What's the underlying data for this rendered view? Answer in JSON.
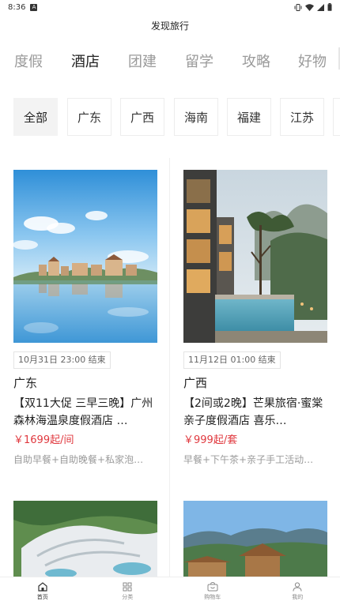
{
  "status_bar": {
    "time": "8:36",
    "app_badge": "A"
  },
  "header": {
    "title": "发现旅行"
  },
  "category_tabs": [
    {
      "label": "度假"
    },
    {
      "label": "酒店",
      "active": true
    },
    {
      "label": "团建"
    },
    {
      "label": "留学"
    },
    {
      "label": "攻略"
    },
    {
      "label": "好物"
    }
  ],
  "region_chips": [
    {
      "label": "全部",
      "active": true
    },
    {
      "label": "广东"
    },
    {
      "label": "广西"
    },
    {
      "label": "海南"
    },
    {
      "label": "福建"
    },
    {
      "label": "江苏"
    }
  ],
  "products": [
    {
      "end_time": "10月31日 23:00 结束",
      "region": "广东",
      "title": "【双11大促 三早三晚】广州森林海温泉度假酒店 …",
      "price": "￥1699起/间",
      "desc": "自助早餐+自助晚餐+私家泡…"
    },
    {
      "end_time": "11月12日 01:00 结束",
      "region": "广西",
      "title": "【2间或2晚】芒果旅宿·蜜棠亲子度假酒店 喜乐…",
      "price": "￥999起/套",
      "desc": "早餐+下午茶+亲子手工活动…"
    },
    {
      "image": "resort-aerial"
    },
    {
      "image": "thatched-hut-mountains"
    }
  ],
  "bottom_nav": [
    {
      "label": "首页",
      "icon": "home-icon",
      "active": true
    },
    {
      "label": "分类",
      "icon": "grid-icon"
    },
    {
      "label": "购物车",
      "icon": "cart-icon"
    },
    {
      "label": "我的",
      "icon": "user-icon"
    }
  ],
  "colors": {
    "price": "#e0383e",
    "muted": "#9a9a9a",
    "chip_active_bg": "#f3f3f3"
  }
}
